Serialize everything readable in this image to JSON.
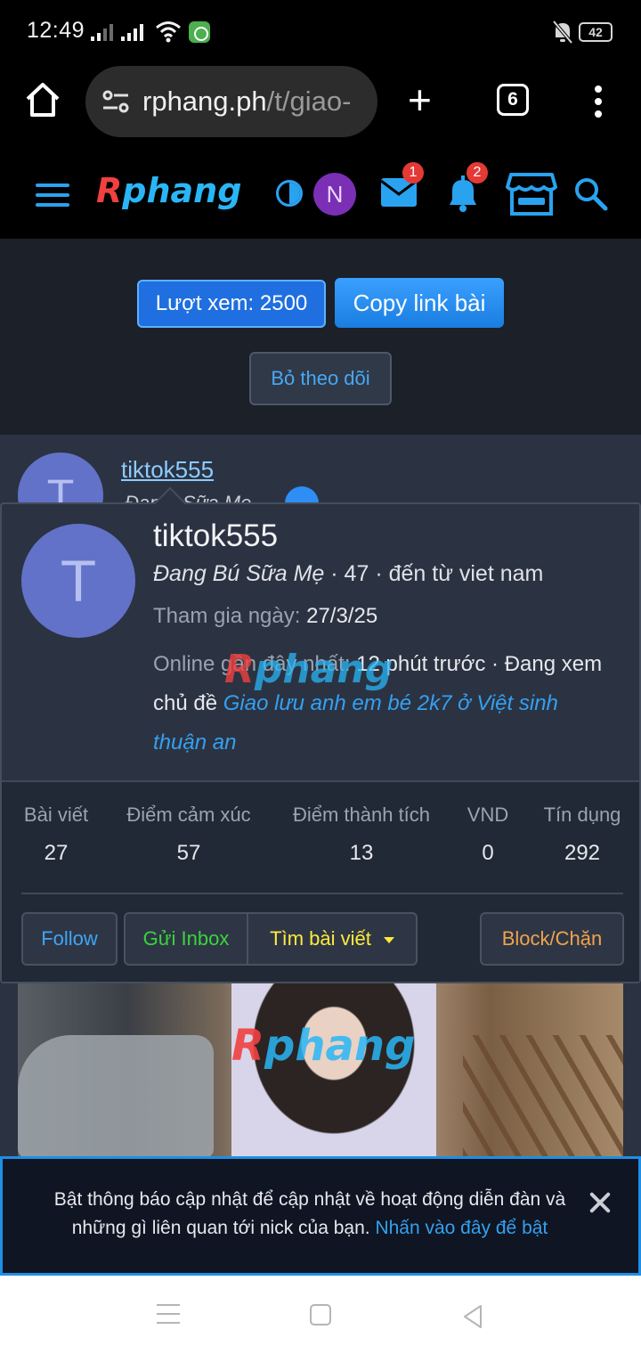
{
  "status_bar": {
    "time": "12:49",
    "battery": "42"
  },
  "browser": {
    "url_host": "rphang.ph",
    "url_path": "/t/giao-",
    "tab_count": "6"
  },
  "site_header": {
    "logo": "Rphang",
    "avatar_initial": "N",
    "inbox_badge": "1",
    "alerts_badge": "2"
  },
  "thread_tools": {
    "views_label": "Lượt xem: 2500",
    "copy_link_label": "Copy link bài",
    "unfollow_label": "Bỏ theo dõi"
  },
  "post": {
    "username": "tiktok555",
    "avatar_initial": "T",
    "title_fragment": "Đan   ú Sữa Mẹ",
    "image_watermark": "Rphang"
  },
  "member_card": {
    "avatar_initial": "T",
    "username": "tiktok555",
    "user_title": "Đang Bú Sữa Mẹ",
    "age_location": " · 47 · đến từ viet nam",
    "joined_label": "Tham gia ngày: ",
    "joined_value": "27/3/25",
    "online_label": "Online gần đây nhất: ",
    "online_value": "12 phút trước · Đang xem chủ đề ",
    "online_link": "Giao lưu anh em bé 2k7 ở Việt sinh thuận an",
    "watermark": "Rphang",
    "stats": [
      {
        "label": "Bài viết",
        "value": "27"
      },
      {
        "label": "Điểm cảm xúc",
        "value": "57"
      },
      {
        "label": "Điểm thành tích",
        "value": "13"
      },
      {
        "label": "VND",
        "value": "0"
      },
      {
        "label": "Tín dụng",
        "value": "292"
      }
    ],
    "buttons": {
      "follow": "Follow",
      "inbox": "Gửi Inbox",
      "find_posts": "Tìm bài viết",
      "block": "Block/Chặn"
    }
  },
  "notification": {
    "text": "Bật thông báo cập nhật để cập nhật về hoạt động diễn đàn và những gì liên quan tới nick của bạn. ",
    "link": "Nhấn vào đây để bật"
  },
  "colors": {
    "accent": "#29a3f0",
    "panel": "#2b3342",
    "follow": "#3fa6f3",
    "inbox": "#3ad43a",
    "find": "#ffeb3b",
    "block": "#f0a44a"
  }
}
